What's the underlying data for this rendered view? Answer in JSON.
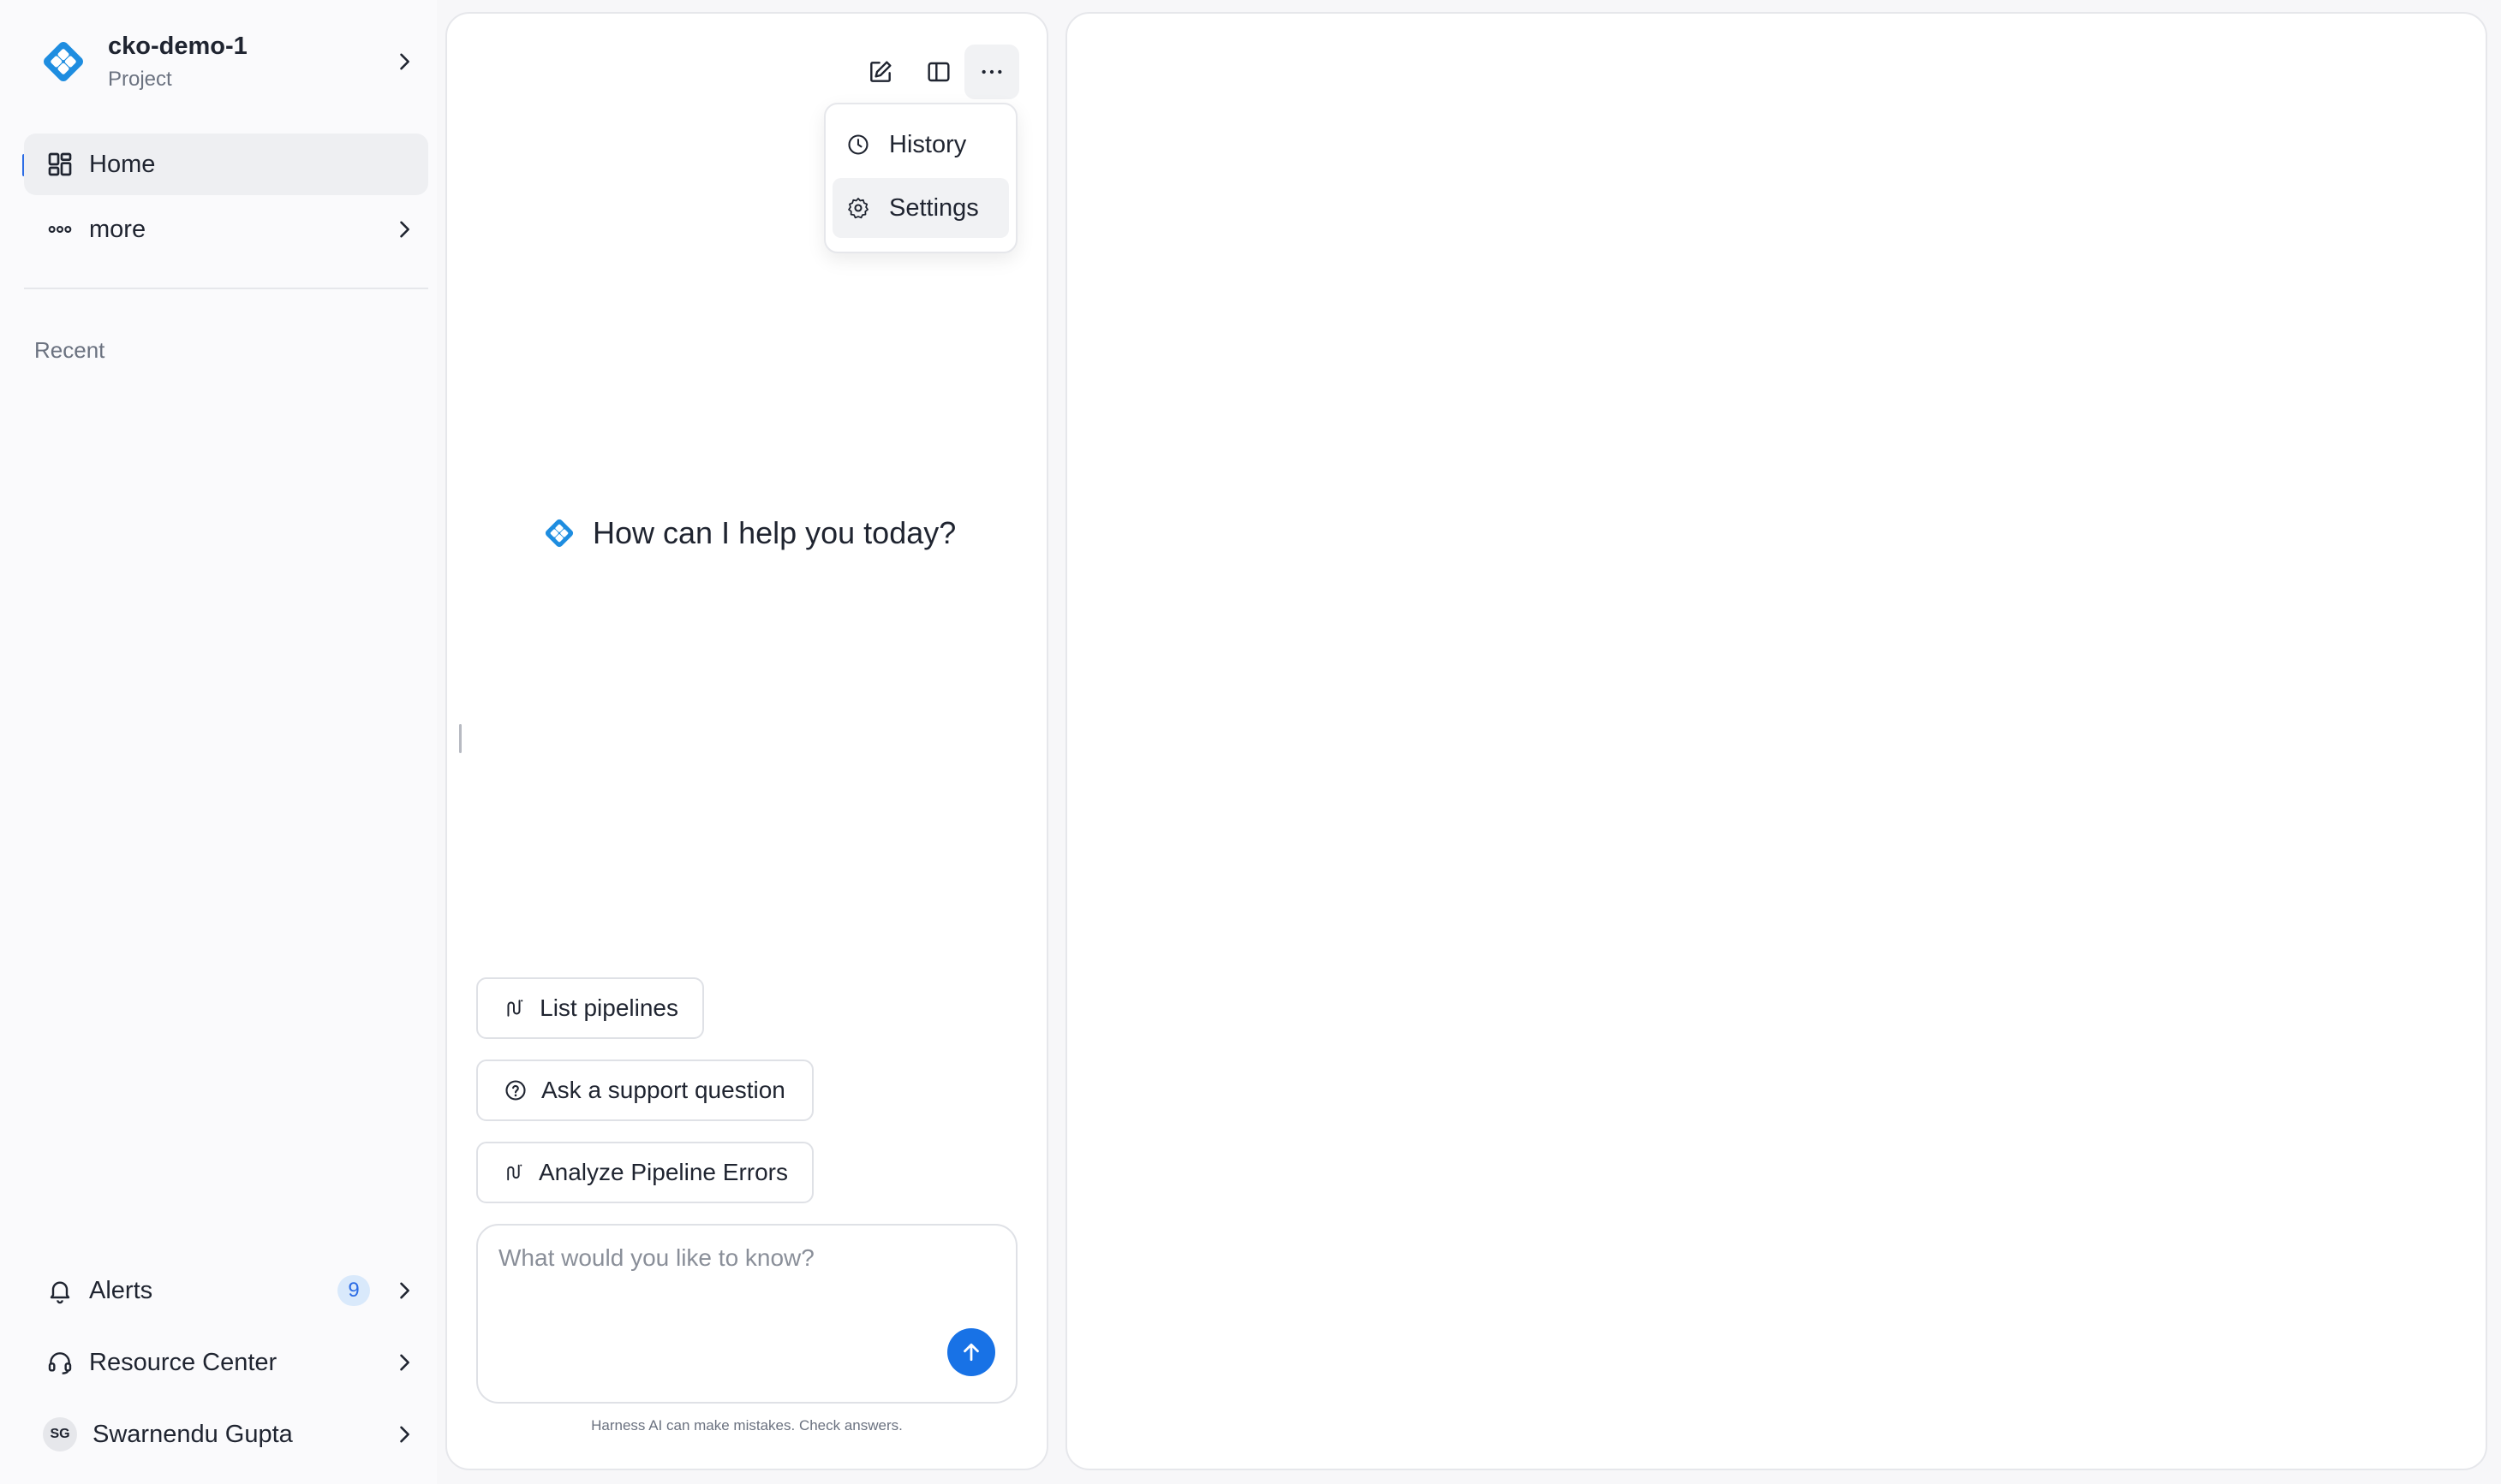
{
  "project": {
    "name": "cko-demo-1",
    "type": "Project"
  },
  "nav": {
    "home": "Home",
    "more": "more"
  },
  "sidebar": {
    "recent_label": "Recent"
  },
  "bottom": {
    "alerts_label": "Alerts",
    "alerts_count": "9",
    "resource_label": "Resource Center",
    "user_initials": "SG",
    "user_name": "Swarnendu Gupta"
  },
  "menu": {
    "history": "History",
    "settings": "Settings"
  },
  "chat": {
    "greeting": "How can I help you today?",
    "suggestions": [
      "List pipelines",
      "Ask a support question",
      "Analyze Pipeline Errors"
    ],
    "input_placeholder": "What would you like to know?",
    "disclaimer": "Harness AI can make mistakes. Check answers."
  },
  "colors": {
    "accent": "#1872e6",
    "logo": "#1e8de0",
    "badge_bg": "#d9e9fb"
  },
  "icons": {
    "logo": "harness-logo-icon",
    "home": "grid-icon",
    "more": "dots-icon",
    "alerts": "bell-icon",
    "resource": "headset-icon",
    "history": "clock-icon",
    "settings": "gear-icon",
    "new_chat": "edit-icon",
    "split": "sidebar-toggle-icon",
    "menu": "ellipsis-icon",
    "pipeline": "pipeline-icon",
    "support": "question-circle-icon",
    "send": "arrow-up-icon"
  }
}
